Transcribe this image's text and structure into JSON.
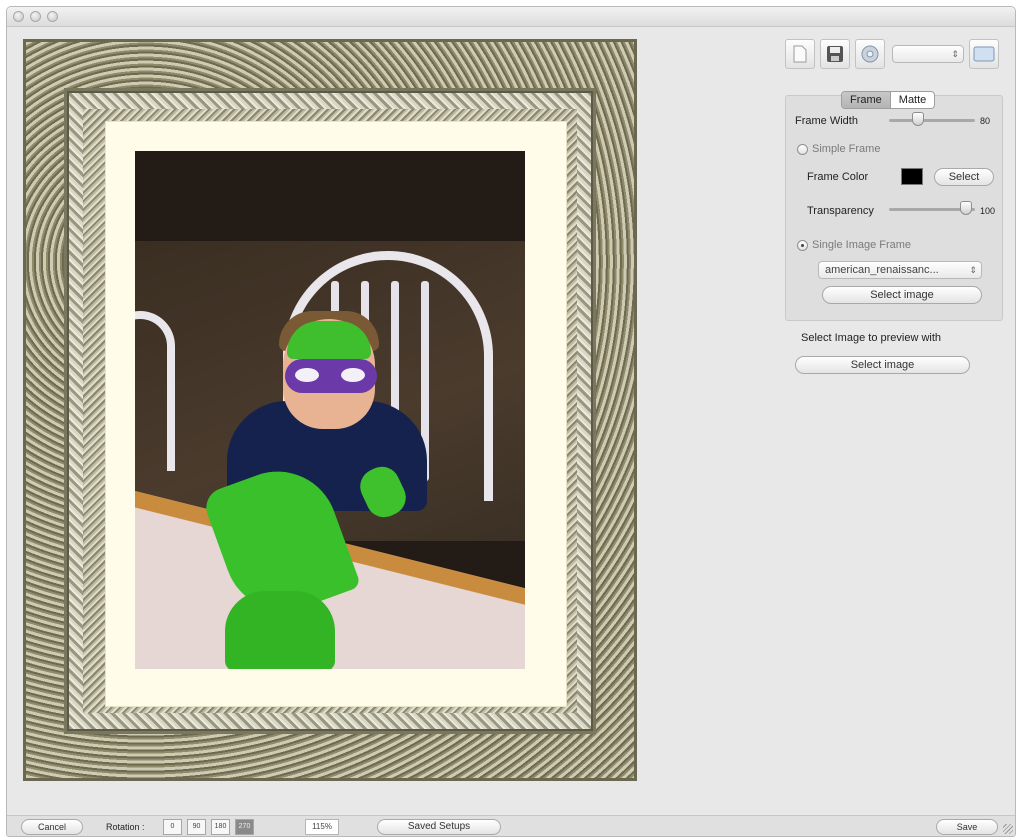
{
  "toolbar": {
    "icons": [
      "new-document-icon",
      "save-icon",
      "gear-icon",
      "window-icon"
    ],
    "popup_value": ""
  },
  "tabs": [
    {
      "label": "Frame",
      "selected": true
    },
    {
      "label": "Matte",
      "selected": false
    }
  ],
  "frame_panel": {
    "frame_width_label": "Frame Width",
    "frame_width_value": "80",
    "simple_frame_label": "Simple Frame",
    "simple_frame_selected": false,
    "frame_color_label": "Frame Color",
    "frame_color": "#000000",
    "select_color_button": "Select",
    "transparency_label": "Transparency",
    "transparency_value": "100",
    "single_image_frame_label": "Single Image Frame",
    "single_image_frame_selected": true,
    "frame_image_popup": "american_renaissanc...",
    "select_frame_image_button": "Select image"
  },
  "preview_panel": {
    "label": "Select Image to preview with",
    "button": "Select image"
  },
  "bottom_bar": {
    "cancel": "Cancel",
    "rotation_label": "Rotation :",
    "rotations": [
      "0",
      "90",
      "180",
      "270"
    ],
    "rotation_selected": "270",
    "zoom": "115%",
    "saved_setups": "Saved Setups",
    "save": "Save"
  }
}
